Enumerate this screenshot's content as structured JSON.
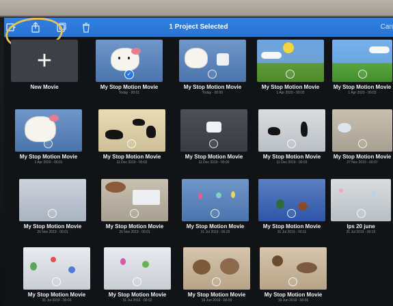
{
  "toolbar": {
    "title": "1 Project Selected",
    "cancel_label": "Can"
  },
  "new_movie_label": "New Movie",
  "projects": [
    {
      "title": "My Stop Motion Movie",
      "sub": "Today - 00:01",
      "selected": true
    },
    {
      "title": "My Stop Motion Movie",
      "sub": "Today - 00:00",
      "selected": false
    },
    {
      "title": "My Stop Motion Movie",
      "sub": "1 Apr 2020 - 00:02",
      "selected": false
    },
    {
      "title": "My Stop Motion Movie",
      "sub": "1 Apr 2020 - 00:03",
      "selected": false
    },
    {
      "title": "My Stop Motion Movie",
      "sub": "1 Apr 2020 - 00:01",
      "selected": false
    },
    {
      "title": "My Stop Motion Movie",
      "sub": "11 Dec 2019 - 00:02",
      "selected": false
    },
    {
      "title": "My Stop Motion Movie",
      "sub": "11 Dec 2019 - 00:00",
      "selected": false
    },
    {
      "title": "My Stop Motion Movie",
      "sub": "11 Dec 2019 - 00:03",
      "selected": false
    },
    {
      "title": "My Stop Motion Movie",
      "sub": "27 Nov 2019 - 00:07",
      "selected": false
    },
    {
      "title": "My Stop Motion Movie",
      "sub": "26 Nov 2019 - 00:01",
      "selected": false
    },
    {
      "title": "My Stop Motion Movie",
      "sub": "26 Nov 2019 - 00:01",
      "selected": false
    },
    {
      "title": "My Stop Motion Movie",
      "sub": "31 Jul 2019 - 00:25",
      "selected": false
    },
    {
      "title": "My Stop Motion Movie",
      "sub": "31 Jul 2019 - 00:11",
      "selected": false
    },
    {
      "title": "lps 20 june",
      "sub": "31 Jul 2019 - 00:16",
      "selected": false
    },
    {
      "title": "My Stop Motion Movie",
      "sub": "31 Jul 2019 - 00:03",
      "selected": false
    },
    {
      "title": "My Stop Motion Movie",
      "sub": "31 Jul 2019 - 00:02",
      "selected": false
    },
    {
      "title": "My Stop Motion Movie",
      "sub": "19 Jun 2019 - 00:09",
      "selected": false
    },
    {
      "title": "My Stop Motion Movie",
      "sub": "19 Jun 2019 - 00:06",
      "selected": false
    }
  ],
  "colors": {
    "toolbar_blue": "#2f7fe0",
    "select_blue": "#2b7ae3",
    "marker_yellow": "#e3c35a"
  }
}
